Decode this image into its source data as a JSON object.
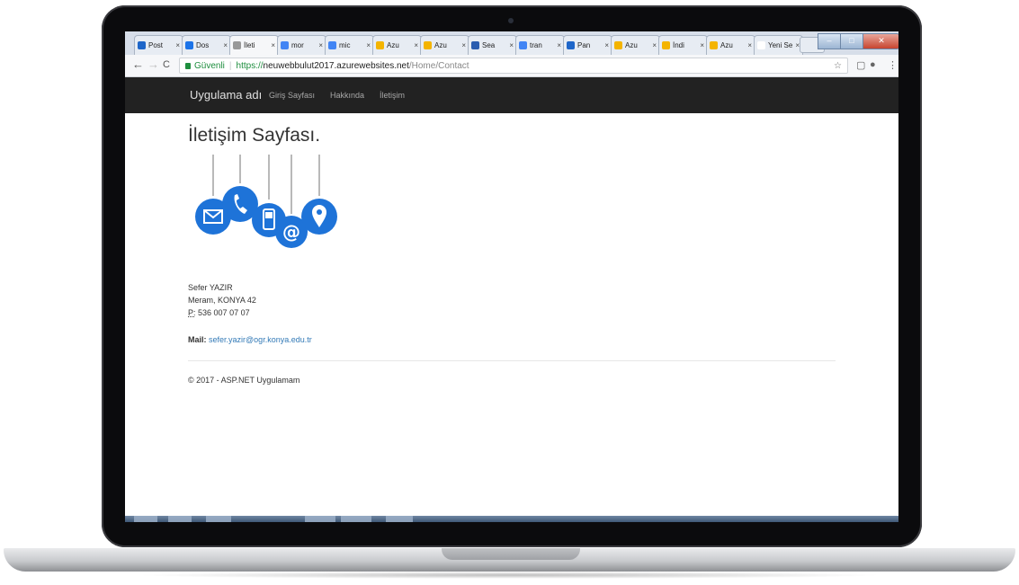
{
  "browser": {
    "tabs": [
      {
        "label": "Post",
        "favicon_color": "#1e66c9"
      },
      {
        "label": "Dos",
        "favicon_color": "#1b73e8"
      },
      {
        "label": "İleti",
        "favicon_color": "#999999",
        "active": true
      },
      {
        "label": "mor",
        "favicon_color": "#4285f4"
      },
      {
        "label": "mic",
        "favicon_color": "#4285f4"
      },
      {
        "label": "Azu",
        "favicon_color": "#f4b400"
      },
      {
        "label": "Azu",
        "favicon_color": "#f4b400"
      },
      {
        "label": "Sea",
        "favicon_color": "#2a5db0"
      },
      {
        "label": "tran",
        "favicon_color": "#4285f4"
      },
      {
        "label": "Pan",
        "favicon_color": "#1e66c9"
      },
      {
        "label": "Azu",
        "favicon_color": "#f4b400"
      },
      {
        "label": "İndi",
        "favicon_color": "#f4b400"
      },
      {
        "label": "Azu",
        "favicon_color": "#f4b400"
      },
      {
        "label": "Yeni Se",
        "favicon_color": "#ffffff"
      }
    ],
    "address": {
      "secure_label": "Güvenli",
      "scheme": "https://",
      "host": "neuwebbulut2017.azurewebsites.net",
      "path": "/Home/Contact"
    }
  },
  "site": {
    "brand": "Uygulama adı",
    "nav": [
      "Giriş Sayfası",
      "Hakkında",
      "İletişim"
    ]
  },
  "page": {
    "title": "İletişim Sayfası.",
    "address_lines": [
      "Sefer YAZIR",
      "Meram, KONYA 42"
    ],
    "phone_label": "P:",
    "phone": "536 007 07 07",
    "mail_label": "Mail:",
    "mail": "sefer.yazir@ogr.konya.edu.tr",
    "footer": "© 2017 - ASP.NET Uygulamam"
  },
  "colors": {
    "navbar": "#222222",
    "link": "#337ab7",
    "icon_blue": "#1e73d8"
  }
}
